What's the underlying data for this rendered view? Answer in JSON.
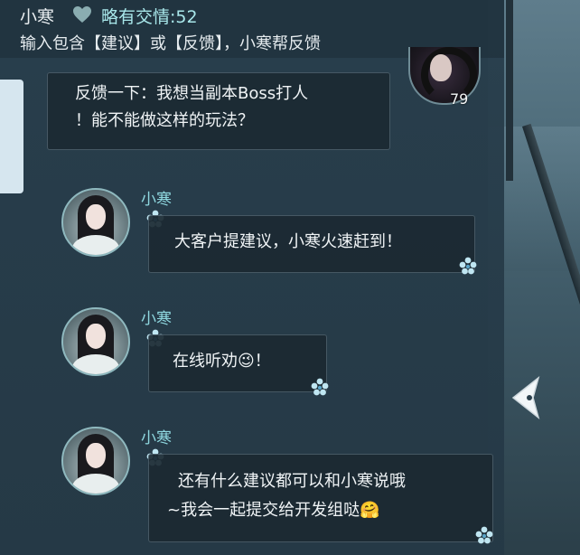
{
  "header": {
    "name": "小寒",
    "affinity": "略有交情:52",
    "hint": "输入包含【建议】或【反馈】，小寒帮反馈"
  },
  "user_message": {
    "line1": "反馈一下：我想当副本Boss打人",
    "line2": "！能不能做这样的玩法？",
    "level": "79"
  },
  "npc_messages": [
    {
      "name": "小寒",
      "line1": "大客户提建议，小寒火速赶到！",
      "line2": ""
    },
    {
      "name": "小寒",
      "line1": "在线听劝",
      "emoji": "😉",
      "tail": "！"
    },
    {
      "name": "小寒",
      "line1": "还有什么建议都可以和小寒说哦",
      "line2": "~我会一起提交给开发组哒",
      "emoji": "🤗"
    }
  ],
  "icons": {
    "affinity": "heart-icon",
    "flower": "flower-icon",
    "collapse": "chevron-left-icon"
  },
  "colors": {
    "npc_name": "#8fd8e0",
    "affinity": "#a8e7ea",
    "bubble_bg": "#1b2932",
    "panel_bg": "#283e4c"
  }
}
